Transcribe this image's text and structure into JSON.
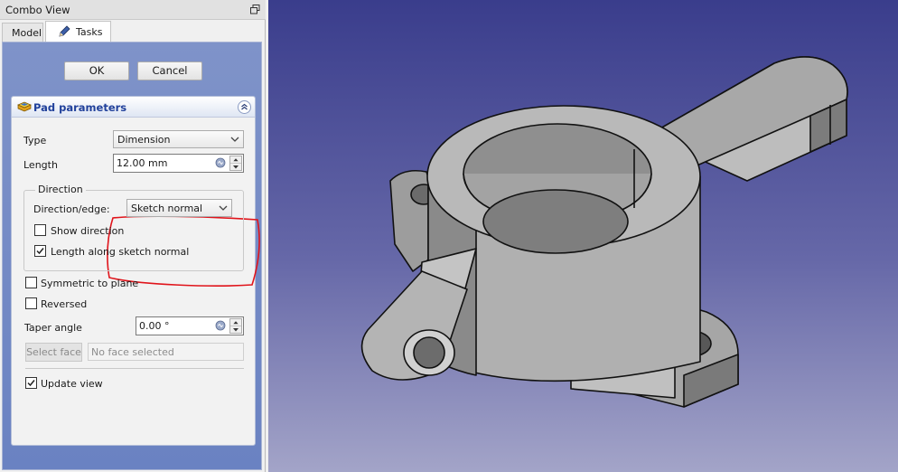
{
  "combo_view": {
    "title": "Combo View",
    "tabs": [
      {
        "label": "Model",
        "active": false
      },
      {
        "label": "Tasks",
        "active": true
      }
    ]
  },
  "dialog_buttons": {
    "ok": "OK",
    "cancel": "Cancel"
  },
  "pad_parameters": {
    "title": "Pad parameters",
    "type_label": "Type",
    "type_value": "Dimension",
    "length_label": "Length",
    "length_value": "12.00 mm",
    "direction": {
      "legend": "Direction",
      "edge_label": "Direction/edge:",
      "edge_value": "Sketch normal",
      "show_direction": {
        "label": "Show direction",
        "checked": false
      },
      "along_normal": {
        "label": "Length along sketch normal",
        "checked": true
      }
    },
    "symmetric": {
      "label": "Symmetric to plane",
      "checked": false
    },
    "reversed": {
      "label": "Reversed",
      "checked": false
    },
    "taper_label": "Taper angle",
    "taper_value": "0.00 °",
    "select_face_label": "Select face",
    "face_placeholder": "No face selected",
    "update_view": {
      "label": "Update view",
      "checked": true
    }
  },
  "colors": {
    "viewport_top": "#3a3d8c",
    "viewport_bottom": "#a3a4c8",
    "task_panel": "#6d86c4",
    "highlight": "#e0141b",
    "part_gray": "#a9a9a9"
  }
}
